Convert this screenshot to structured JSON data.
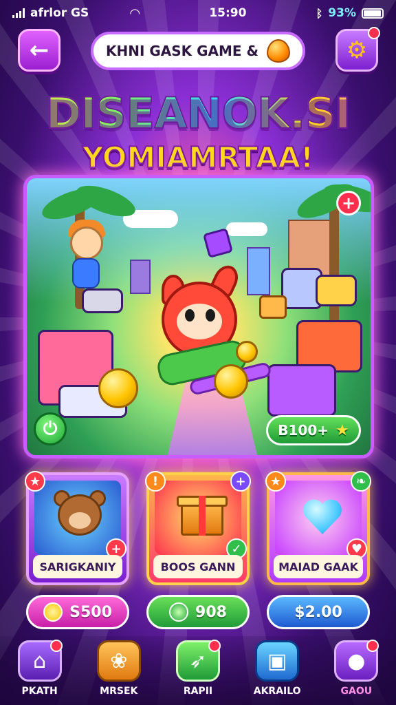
{
  "status_bar": {
    "carrier": "afrlor GS",
    "time": "15:90",
    "battery": "93%"
  },
  "header": {
    "back_icon": "arrow-left-icon",
    "title": "KHNI GASK GAME &",
    "gem_icon": "orange-gem-icon",
    "settings_icon": "gear-icon"
  },
  "headline": {
    "line1": "DISEANOK.SI",
    "line2": "YOMIAMRTAA!"
  },
  "scene": {
    "score": "B100",
    "score_suffix": "+",
    "badge_symbol": "+",
    "power_icon": "power-icon"
  },
  "cards": [
    {
      "label": "SARIGKANIY",
      "art": "bear-icon",
      "price": "S500",
      "accent": "#a64bff"
    },
    {
      "label": "BOOS GANN",
      "art": "gift-box-icon",
      "price": "908",
      "accent": "#ff4a5a"
    },
    {
      "label": "MAIAD GAAK",
      "art": "heart-icon",
      "price": "$2.00",
      "accent": "#ff6ad8"
    }
  ],
  "nav": [
    {
      "label": "PKATH",
      "icon": "home-icon"
    },
    {
      "label": "MRSEK",
      "icon": "gift-icon"
    },
    {
      "label": "RAPII",
      "icon": "rocket-icon"
    },
    {
      "label": "AKRAILO",
      "icon": "cube-icon"
    },
    {
      "label": "GAOU",
      "icon": "palette-icon"
    }
  ],
  "colors": {
    "accent_purple": "#9b1fd0",
    "accent_yellow": "#ffd24a",
    "accent_green": "#21a83a",
    "badge_red": "#ff2f4d"
  }
}
